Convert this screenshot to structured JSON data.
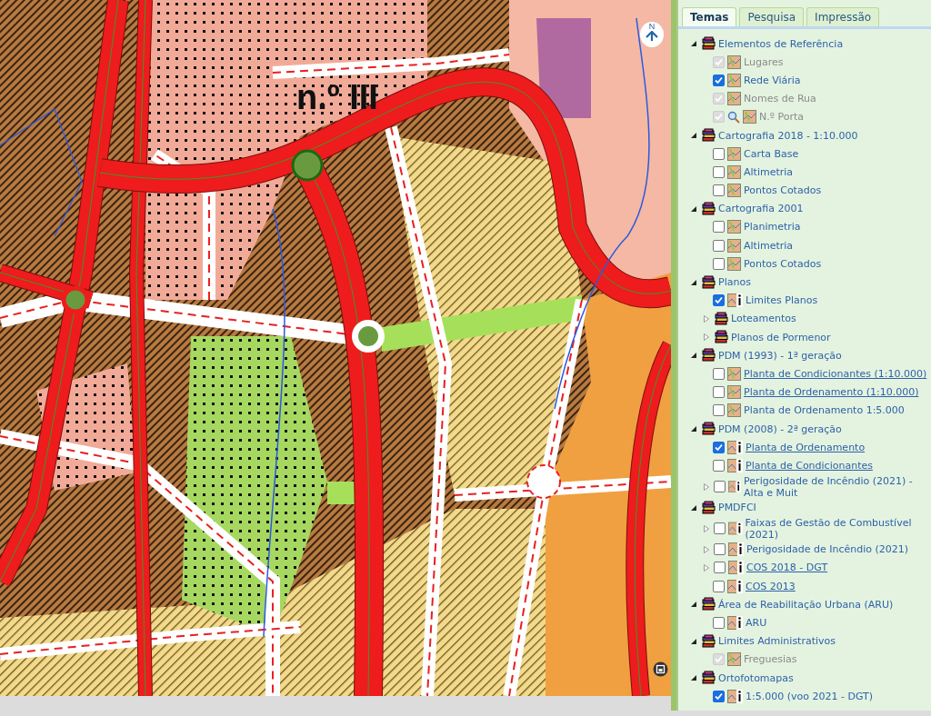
{
  "map": {
    "label": "n.º III",
    "north_label": "N"
  },
  "tabs": [
    {
      "label": "Temas",
      "selected": true
    },
    {
      "label": "Pesquisa",
      "selected": false
    },
    {
      "label": "Impressão",
      "selected": false
    }
  ],
  "groups": [
    {
      "label": "Elementos de Referência",
      "expanded": true,
      "items": [
        {
          "kind": "layer",
          "label": "Lugares",
          "checked": true,
          "disabled": true
        },
        {
          "kind": "layer",
          "label": "Rede Viária",
          "checked": true,
          "disabled": false
        },
        {
          "kind": "layer",
          "label": "Nomes de Rua",
          "checked": true,
          "disabled": true
        },
        {
          "kind": "layer",
          "label": "N.º Porta",
          "checked": true,
          "disabled": true,
          "query": true
        }
      ]
    },
    {
      "label": "Cartografia 2018 - 1:10.000",
      "expanded": true,
      "items": [
        {
          "kind": "layer",
          "label": "Carta Base",
          "checked": false,
          "disabled": false
        },
        {
          "kind": "layer",
          "label": "Altimetria",
          "checked": false,
          "disabled": false
        },
        {
          "kind": "layer",
          "label": "Pontos Cotados",
          "checked": false,
          "disabled": false
        }
      ]
    },
    {
      "label": "Cartografia 2001",
      "expanded": true,
      "items": [
        {
          "kind": "layer",
          "label": "Planimetria",
          "checked": false,
          "disabled": false
        },
        {
          "kind": "layer",
          "label": "Altimetria",
          "checked": false,
          "disabled": false
        },
        {
          "kind": "layer",
          "label": "Pontos Cotados",
          "checked": false,
          "disabled": false
        }
      ]
    },
    {
      "label": "Planos",
      "expanded": true,
      "items": [
        {
          "kind": "layer",
          "label": "Limites Planos",
          "checked": true,
          "disabled": false,
          "info": true
        },
        {
          "kind": "group",
          "label": "Loteamentos",
          "expanded": false
        },
        {
          "kind": "group",
          "label": "Planos de Pormenor",
          "expanded": false
        }
      ]
    },
    {
      "label": "PDM (1993) - 1ª geração",
      "expanded": true,
      "items": [
        {
          "kind": "layer",
          "label": "Planta de Condicionantes (1:10.000)",
          "checked": false,
          "disabled": false,
          "link": true
        },
        {
          "kind": "layer",
          "label": "Planta de Ordenamento (1:10.000)",
          "checked": false,
          "disabled": false,
          "link": true
        },
        {
          "kind": "layer",
          "label": "Planta de Ordenamento 1:5.000",
          "checked": false,
          "disabled": false
        }
      ]
    },
    {
      "label": "PDM (2008) - 2ª geração",
      "expanded": true,
      "items": [
        {
          "kind": "layer",
          "label": "Planta de Ordenamento",
          "checked": true,
          "disabled": false,
          "info": true,
          "link": true
        },
        {
          "kind": "layer",
          "label": "Planta de Condicionantes",
          "checked": false,
          "disabled": false,
          "info": true,
          "link": true
        },
        {
          "kind": "layer",
          "label": "Perigosidade de Incêndio (2021) - Alta e Muit",
          "checked": false,
          "disabled": false,
          "info": true,
          "expanded": false
        }
      ]
    },
    {
      "label": "PMDFCI",
      "expanded": true,
      "items": [
        {
          "kind": "layer",
          "label": "Faixas de Gestão de Combustível (2021)",
          "checked": false,
          "disabled": false,
          "info": true,
          "expanded": false
        },
        {
          "kind": "layer",
          "label": "Perigosidade de Incêndio (2021)",
          "checked": false,
          "disabled": false,
          "info": true,
          "expanded": false
        },
        {
          "kind": "layer",
          "label": "COS 2018 - DGT",
          "checked": false,
          "disabled": false,
          "info": true,
          "link": true,
          "expanded": false
        },
        {
          "kind": "layer",
          "label": "COS 2013",
          "checked": false,
          "disabled": false,
          "info": true,
          "link": true
        }
      ]
    },
    {
      "label": "Área de Reabilitação Urbana (ARU)",
      "expanded": true,
      "items": [
        {
          "kind": "layer",
          "label": "ARU",
          "checked": false,
          "disabled": false,
          "info": true
        }
      ]
    },
    {
      "label": "Limites Administrativos",
      "expanded": true,
      "items": [
        {
          "kind": "layer",
          "label": "Freguesias",
          "checked": true,
          "disabled": true
        }
      ]
    },
    {
      "label": "Ortofotomapas",
      "expanded": true,
      "items": [
        {
          "kind": "layer",
          "label": "1:5.000 (voo 2021 - DGT)",
          "checked": true,
          "disabled": false,
          "info": true
        }
      ]
    }
  ]
}
